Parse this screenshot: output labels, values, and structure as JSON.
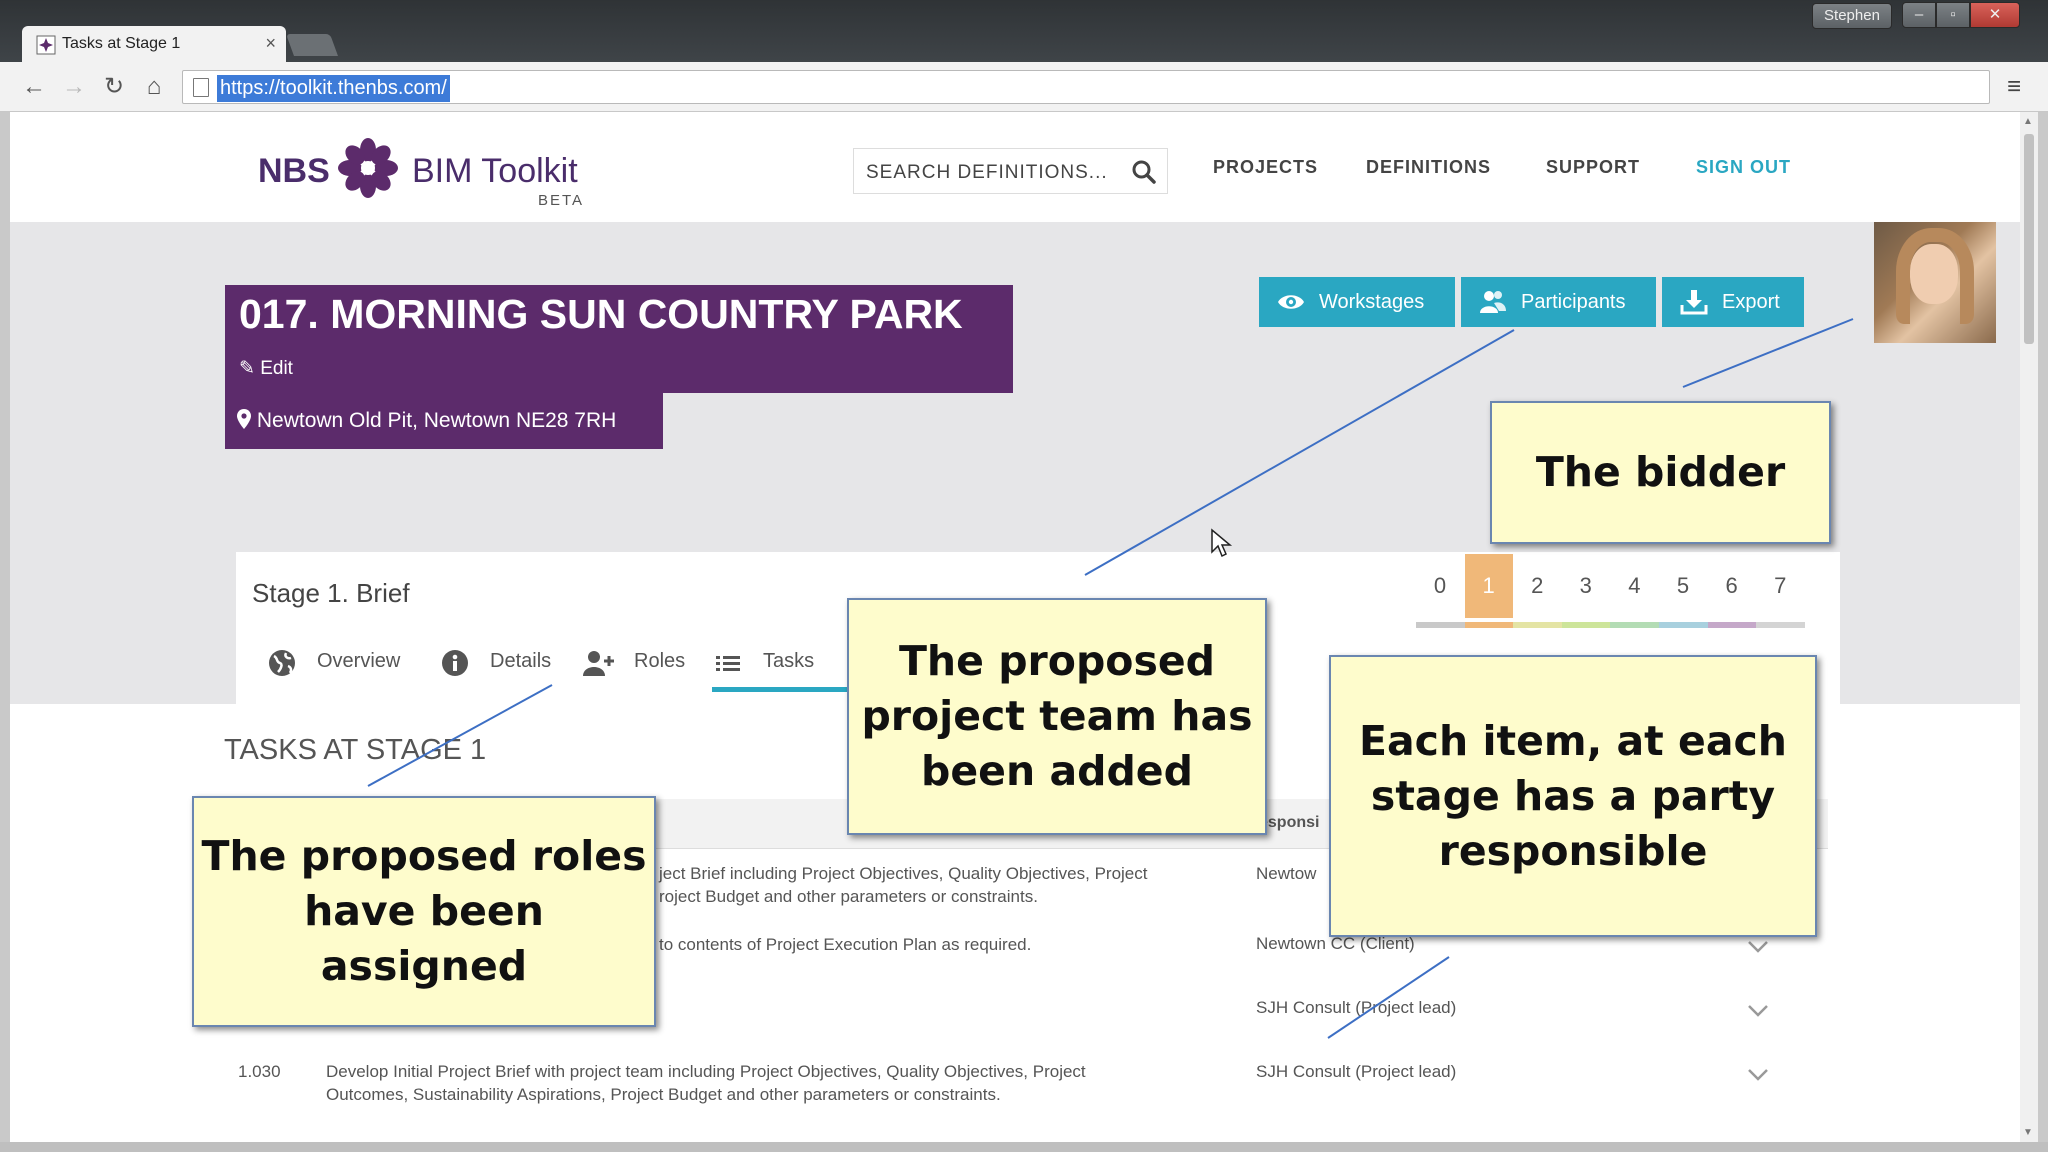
{
  "browser": {
    "tab_title": "Tasks at Stage 1",
    "tab_close": "×",
    "user_badge": "Stephen",
    "window_buttons": {
      "minimize": "–",
      "maximize": "▫",
      "close": "✕"
    },
    "url": "https://toolkit.thenbs.com/",
    "nav": {
      "back": "←",
      "forward": "→",
      "reload": "↻",
      "home": "⌂",
      "menu": "≡"
    }
  },
  "site": {
    "logo": {
      "nbs": "NBS",
      "product": "BIM Toolkit",
      "beta": "BETA"
    },
    "search": {
      "placeholder": "SEARCH DEFINITIONS..."
    },
    "nav": {
      "projects": "PROJECTS",
      "definitions": "DEFINITIONS",
      "support": "SUPPORT",
      "sign_out": "SIGN OUT"
    },
    "accent_color": "#2aa7c2",
    "brand_color": "#5c2b6b"
  },
  "project": {
    "title": "017. MORNING SUN COUNTRY PARK",
    "edit_label": "Edit",
    "address": "Newtown Old Pit, Newtown NE28 7RH"
  },
  "actions": {
    "workstages": "Workstages",
    "participants": "Participants",
    "export": "Export"
  },
  "stage": {
    "title": "Stage 1. Brief",
    "numbers": [
      "0",
      "1",
      "2",
      "3",
      "4",
      "5",
      "6",
      "7"
    ],
    "active": "1",
    "bar_colors": [
      "#c9c9c9",
      "#f0b879",
      "#e4e4a4",
      "#cde59a",
      "#b3dcb4",
      "#a8d0de",
      "#c5a8c9",
      "#d4d4d4"
    ],
    "tabs": {
      "overview": "Overview",
      "details": "Details",
      "roles": "Roles",
      "tasks": "Tasks"
    }
  },
  "tasks": {
    "heading": "TASKS AT STAGE 1",
    "responsible_header": "esponsi",
    "rows": [
      {
        "text_line1": "ject Brief including Project Objectives, Quality Objectives, Project",
        "text_line2": "roject Budget and other parameters or constraints.",
        "responsible": "Newtow"
      },
      {
        "text_line1": "to contents of Project Execution Plan as required.",
        "responsible": "Newtown CC (Client)"
      },
      {
        "responsible": "SJH Consult (Project lead)"
      },
      {
        "number": "1.030",
        "text_line1": "Develop Initial Project Brief with project team including Project Objectives, Quality Objectives, Project",
        "text_line2": "Outcomes, Sustainability Aspirations, Project Budget and other parameters or constraints.",
        "responsible": "SJH Consult (Project lead)"
      }
    ]
  },
  "callouts": {
    "bidder": "The bidder",
    "team": "The proposed project team has been added",
    "party": "Each item, at each stage has a party responsible",
    "roles": "The proposed roles have been assigned"
  }
}
